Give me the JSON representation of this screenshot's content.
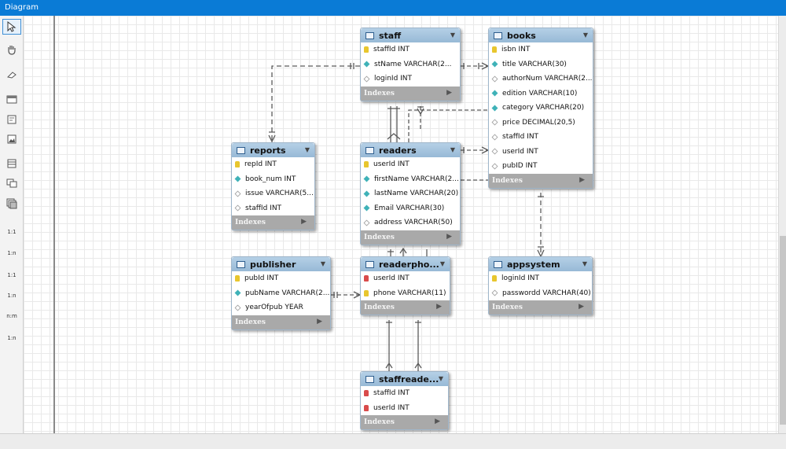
{
  "window": {
    "title": "Diagram"
  },
  "toolbox": {
    "rel_labels": [
      "1:1",
      "1:n",
      "1:1",
      "1:n",
      "n:m",
      "1:n"
    ]
  },
  "indexes_label": "Indexes",
  "entities": {
    "staff": {
      "name": "staff",
      "columns": [
        {
          "text": "staffId INT",
          "kind": "pk"
        },
        {
          "text": "stName VARCHAR(2...",
          "kind": "nn"
        },
        {
          "text": "loginId INT",
          "kind": "null"
        }
      ]
    },
    "books": {
      "name": "books",
      "columns": [
        {
          "text": "isbn INT",
          "kind": "pk"
        },
        {
          "text": "title VARCHAR(30)",
          "kind": "nn"
        },
        {
          "text": "authorNum VARCHAR(2...",
          "kind": "null"
        },
        {
          "text": "edition VARCHAR(10)",
          "kind": "nn"
        },
        {
          "text": "category VARCHAR(20)",
          "kind": "nn"
        },
        {
          "text": "price DECIMAL(20,5)",
          "kind": "null"
        },
        {
          "text": "staffId INT",
          "kind": "null"
        },
        {
          "text": "userId INT",
          "kind": "null"
        },
        {
          "text": "pubID INT",
          "kind": "null"
        }
      ]
    },
    "reports": {
      "name": "reports",
      "columns": [
        {
          "text": "repId INT",
          "kind": "pk"
        },
        {
          "text": "book_num INT",
          "kind": "nn"
        },
        {
          "text": "issue VARCHAR(5...",
          "kind": "null"
        },
        {
          "text": "staffId INT",
          "kind": "null"
        }
      ]
    },
    "readers": {
      "name": "readers",
      "columns": [
        {
          "text": "userId INT",
          "kind": "pk"
        },
        {
          "text": "firstName VARCHAR(2...",
          "kind": "nn"
        },
        {
          "text": "lastName VARCHAR(20)",
          "kind": "nn"
        },
        {
          "text": "Email VARCHAR(30)",
          "kind": "nn"
        },
        {
          "text": "address VARCHAR(50)",
          "kind": "null"
        }
      ]
    },
    "publisher": {
      "name": "publisher",
      "columns": [
        {
          "text": "pubId INT",
          "kind": "pk"
        },
        {
          "text": "pubName VARCHAR(2...",
          "kind": "nn"
        },
        {
          "text": "yearOfpub YEAR",
          "kind": "null"
        }
      ]
    },
    "readerphone": {
      "name": "readerpho...",
      "columns": [
        {
          "text": "userId INT",
          "kind": "fk"
        },
        {
          "text": "phone VARCHAR(11)",
          "kind": "pk"
        }
      ]
    },
    "appsystem": {
      "name": "appsystem",
      "columns": [
        {
          "text": "loginId INT",
          "kind": "pk"
        },
        {
          "text": "passwordd VARCHAR(40)",
          "kind": "null"
        }
      ]
    },
    "staffreader": {
      "name": "staffreade...",
      "columns": [
        {
          "text": "staffId INT",
          "kind": "fk"
        },
        {
          "text": "userId INT",
          "kind": "fk"
        }
      ]
    }
  }
}
